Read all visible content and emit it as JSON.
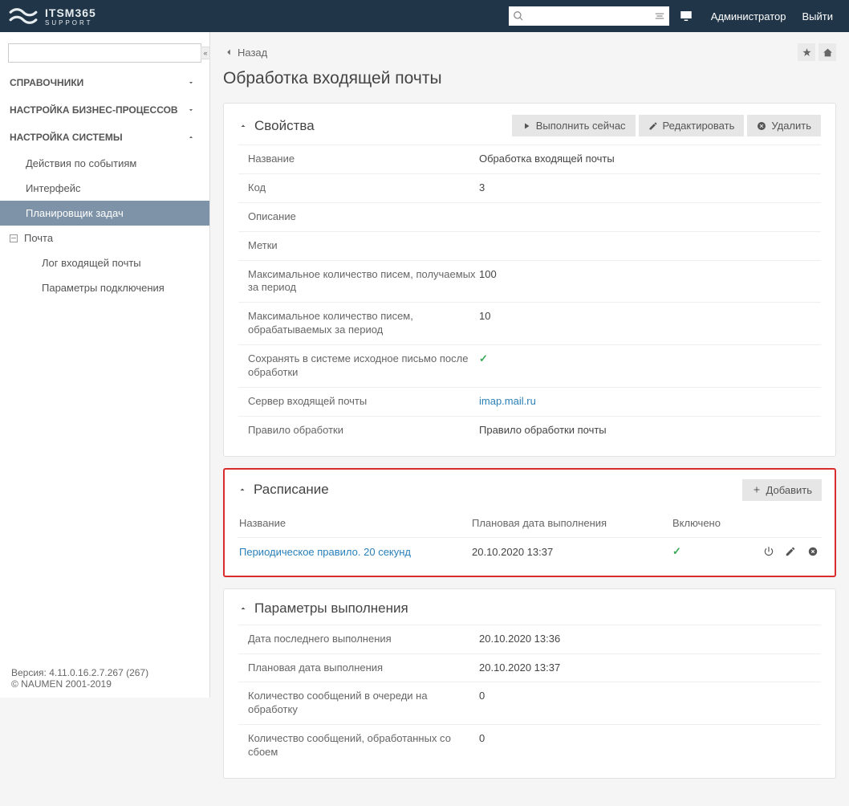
{
  "header": {
    "brand": "ITSM365",
    "sub": "SUPPORT",
    "search_placeholder": "",
    "admin": "Администратор",
    "logout": "Выйти"
  },
  "sidebar": {
    "sections": {
      "references": "СПРАВОЧНИКИ",
      "biz": "НАСТРОЙКА БИЗНЕС-ПРОЦЕССОВ",
      "sys": "НАСТРОЙКА СИСТЕМЫ"
    },
    "sys_items": {
      "events": "Действия по событиям",
      "interface": "Интерфейс",
      "scheduler": "Планировщик задач"
    },
    "mail_group": "Почта",
    "mail_items": {
      "log": "Лог входящей почты",
      "params": "Параметры подключения"
    },
    "footer_version": "Версия: 4.11.0.16.2.7.267 (267)",
    "footer_copy": "© NAUMEN 2001-2019"
  },
  "page": {
    "back": "Назад",
    "title": "Обработка входящей почты"
  },
  "properties": {
    "card_title": "Свойства",
    "actions": {
      "run": "Выполнить сейчас",
      "edit": "Редактировать",
      "delete": "Удалить"
    },
    "rows": {
      "name_l": "Название",
      "name_v": "Обработка входящей почты",
      "code_l": "Код",
      "code_v": "3",
      "desc_l": "Описание",
      "tags_l": "Метки",
      "maxrecv_l": "Максимальное количество писем, получаемых за период",
      "maxrecv_v": "100",
      "maxproc_l": "Максимальное количество писем, обрабатываемых за период",
      "maxproc_v": "10",
      "keep_l": "Сохранять в системе исходное письмо после обработки",
      "server_l": "Сервер входящей почты",
      "server_v": "imap.mail.ru",
      "rule_l": "Правило обработки",
      "rule_v": "Правило обработки почты"
    }
  },
  "schedule": {
    "card_title": "Расписание",
    "add": "Добавить",
    "head": {
      "name": "Название",
      "plan": "Плановая дата выполнения",
      "enabled": "Включено"
    },
    "row": {
      "name": "Периодическое правило. 20 секунд",
      "plan": "20.10.2020 13:37"
    }
  },
  "exec": {
    "card_title": "Параметры выполнения",
    "rows": {
      "last_l": "Дата последнего выполнения",
      "last_v": "20.10.2020 13:36",
      "plan_l": "Плановая дата выполнения",
      "plan_v": "20.10.2020 13:37",
      "queue_l": "Количество сообщений в очереди на обработку",
      "queue_v": "0",
      "fail_l": "Количество сообщений, обработанных со сбоем",
      "fail_v": "0"
    }
  }
}
